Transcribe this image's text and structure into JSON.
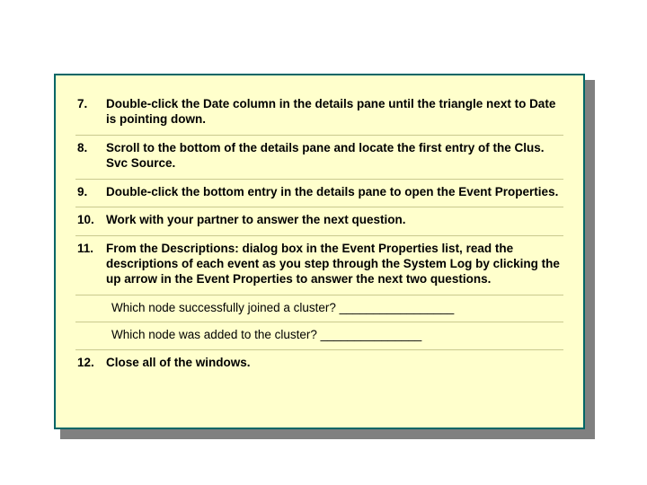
{
  "steps": {
    "s7": {
      "num": "7.",
      "text": "Double-click the Date column in the details pane until the triangle next to Date is pointing down."
    },
    "s8": {
      "num": "8.",
      "text": "Scroll to the bottom of the details pane and locate the first entry of the Clus. Svc Source."
    },
    "s9": {
      "num": "9.",
      "text": "Double-click the bottom entry in the details pane to open the Event Properties."
    },
    "s10": {
      "num": "10.",
      "text": "Work with your partner to answer the next question."
    },
    "s11": {
      "num": "11.",
      "text": "From the Descriptions: dialog box in the Event Properties list, read the descriptions of each event as you step through the System Log by clicking the up arrow in the Event Properties to answer the next two questions."
    },
    "q1": "Which node successfully joined a cluster? _________________",
    "q2": "Which node was added to the cluster? _______________",
    "s12": {
      "num": "12.",
      "text": "Close all of the windows."
    }
  }
}
